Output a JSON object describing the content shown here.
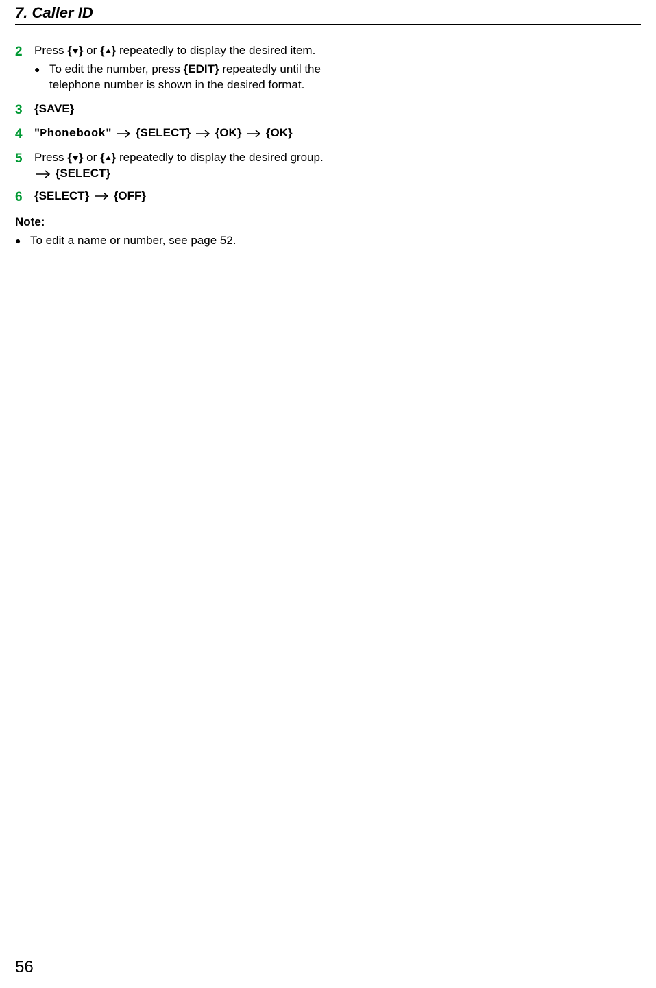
{
  "header": {
    "title": "7. Caller ID"
  },
  "keys": {
    "down": "▼",
    "up": "▲",
    "edit": "EDIT",
    "save": "SAVE",
    "select": "SELECT",
    "ok": "OK",
    "off": "OFF"
  },
  "labels": {
    "phonebook": "Phonebook",
    "note": "Note:"
  },
  "steps": {
    "s2": {
      "num": "2",
      "text_a": "Press ",
      "text_b": " or ",
      "text_c": " repeatedly to display the desired item.",
      "sub_a": "To edit the number, press ",
      "sub_b": " repeatedly until the telephone number is shown in the desired format."
    },
    "s3": {
      "num": "3"
    },
    "s4": {
      "num": "4",
      "quote_open": "\"",
      "quote_close": "\""
    },
    "s5": {
      "num": "5",
      "text_a": "Press ",
      "text_b": " or ",
      "text_c": " repeatedly to display the desired group. "
    },
    "s6": {
      "num": "6"
    }
  },
  "note_bullet": "To edit a name or number, see page 52.",
  "page_number": "56"
}
